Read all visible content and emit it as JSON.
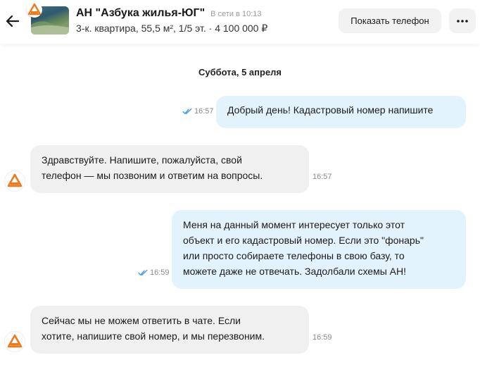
{
  "header": {
    "agency_name": "АН \"Азбука жилья-ЮГ\"",
    "presence": "В сети в 10:13",
    "listing": "3-к. квартира, 55,5 м², 1/5 эт. · 4 100 000 ₽",
    "show_phone_label": "Показать телефон",
    "more_icon": "more-horizontal-icon",
    "back_icon": "arrow-left-icon"
  },
  "date_separator": "Суббота, 5 апреля",
  "messages": [
    {
      "direction": "out",
      "time": "16:57",
      "status": "read",
      "lines": [
        "Добрый день! Кадастровый номер напишите"
      ]
    },
    {
      "direction": "in",
      "time": "16:57",
      "lines": [
        "Здравствуйте. Напишите, пожалуйста, свой",
        "телефон — мы позвоним и ответим на вопросы."
      ]
    },
    {
      "direction": "out",
      "time": "16:59",
      "status": "read",
      "lines": [
        "Меня на данный момент интересует только этот",
        "объект и его кадастровый номер. Если это \"фонарь\"",
        "или просто собираете телефоны в свою базу, то",
        "можете даже не отвечать. Задолбали схемы АН!"
      ]
    },
    {
      "direction": "in",
      "time": "16:59",
      "lines": [
        "Сейчас мы не можем ответить в чате. Если",
        "хотите, напишите свой номер, и мы перезвоним."
      ]
    }
  ],
  "colors": {
    "outgoing_bubble": "#e3f3fd",
    "incoming_bubble": "#f0f0f0",
    "read_check": "#3d9be9",
    "logo_orange": "#f07a1a"
  }
}
